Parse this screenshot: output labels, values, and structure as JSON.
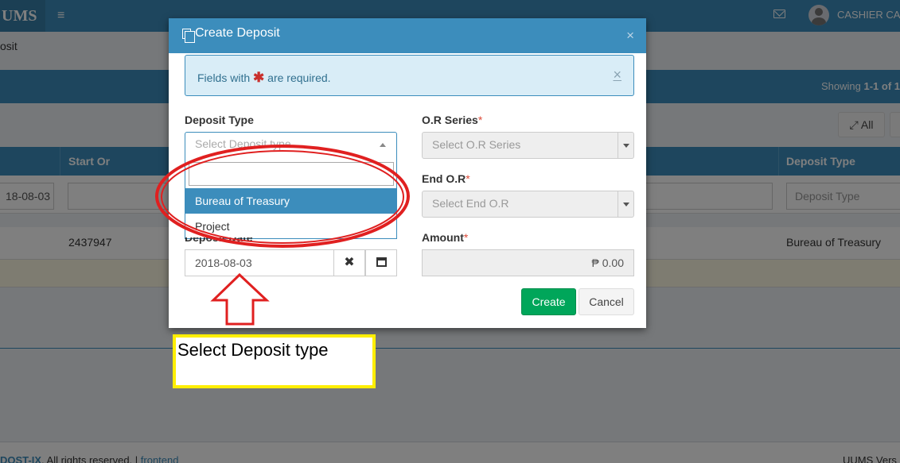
{
  "app": {
    "logo": "UMS",
    "user": "CASHIER CA",
    "breadcrumb": "osit",
    "showing_prefix": "Showing ",
    "showing_range": "1-1",
    "showing_suffix": " of 1",
    "toolbar_all": "All"
  },
  "grid": {
    "headers": {
      "start_or": "Start Or",
      "deposit_type": "Deposit Type"
    },
    "filters": {
      "date": "18-08-03",
      "deposit_type_placeholder": "Deposit Type"
    },
    "row": {
      "start_or": "2437947",
      "deposit_type": "Bureau of Treasury"
    }
  },
  "footer": {
    "brand": "DOST-IX",
    "rights": ". All rights reserved. | ",
    "link": "frontend",
    "right_text": "UUMS Vers"
  },
  "modal": {
    "title": "Create Deposit",
    "alert": {
      "prefix": "Fields with ",
      "star": "✱",
      "suffix": " are required."
    },
    "deposit_type": {
      "label": "Deposit Type",
      "placeholder": "Select Deposit type",
      "options": [
        "Bureau of Treasury",
        "Project"
      ],
      "highlighted": "Bureau of Treasury"
    },
    "deposit_date": {
      "label": "Deposit Date",
      "value": "2018-08-03"
    },
    "or_series": {
      "label": "O.R Series",
      "placeholder": "Select O.R Series"
    },
    "end_or": {
      "label": "End O.R",
      "placeholder": "Select End O.R"
    },
    "amount": {
      "label": "Amount",
      "value": "₱ 0.00"
    },
    "required_mark": "*",
    "buttons": {
      "create": "Create",
      "cancel": "Cancel"
    }
  },
  "annotation": {
    "callout": "Select Deposit type",
    "highlight_color": "#e02020",
    "callout_border": "#ffee00"
  },
  "colors": {
    "primary": "#3c8dbc",
    "success": "#00a65a"
  }
}
